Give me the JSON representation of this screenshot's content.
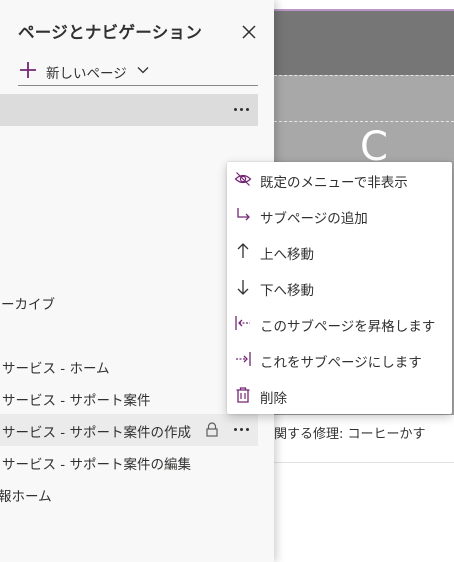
{
  "background_page": {
    "hero_text": "C O",
    "caption": "関する修理: コーヒーかす"
  },
  "nav_panel": {
    "title": "ページとナビゲーション",
    "new_page_label": "新しいページ",
    "items": [
      {
        "label": ""
      },
      {
        "label": "ーカイブ"
      },
      {
        "label": "サービス - ホーム"
      },
      {
        "label": "サービス - サポート案件"
      },
      {
        "label": "サービス - サポート案件の作成"
      },
      {
        "label": "サービス - サポート案件の編集"
      },
      {
        "label": "報ホーム"
      }
    ]
  },
  "context_menu": {
    "items": [
      {
        "label": "既定のメニューで非表示",
        "icon": "hide-icon"
      },
      {
        "label": "サブページの追加",
        "icon": "add-subpage-icon"
      },
      {
        "label": "上へ移動",
        "icon": "arrow-up-icon"
      },
      {
        "label": "下へ移動",
        "icon": "arrow-down-icon"
      },
      {
        "label": "このサブページを昇格します",
        "icon": "promote-icon"
      },
      {
        "label": "これをサブページにします",
        "icon": "demote-icon"
      },
      {
        "label": "削除",
        "icon": "trash-icon"
      }
    ]
  },
  "colors": {
    "accent": "#742774",
    "panel_bg": "#f8f8f8",
    "selected_bg": "#dcdcdc",
    "banner_dark": "#767676",
    "banner_light": "#a8a8a8"
  }
}
